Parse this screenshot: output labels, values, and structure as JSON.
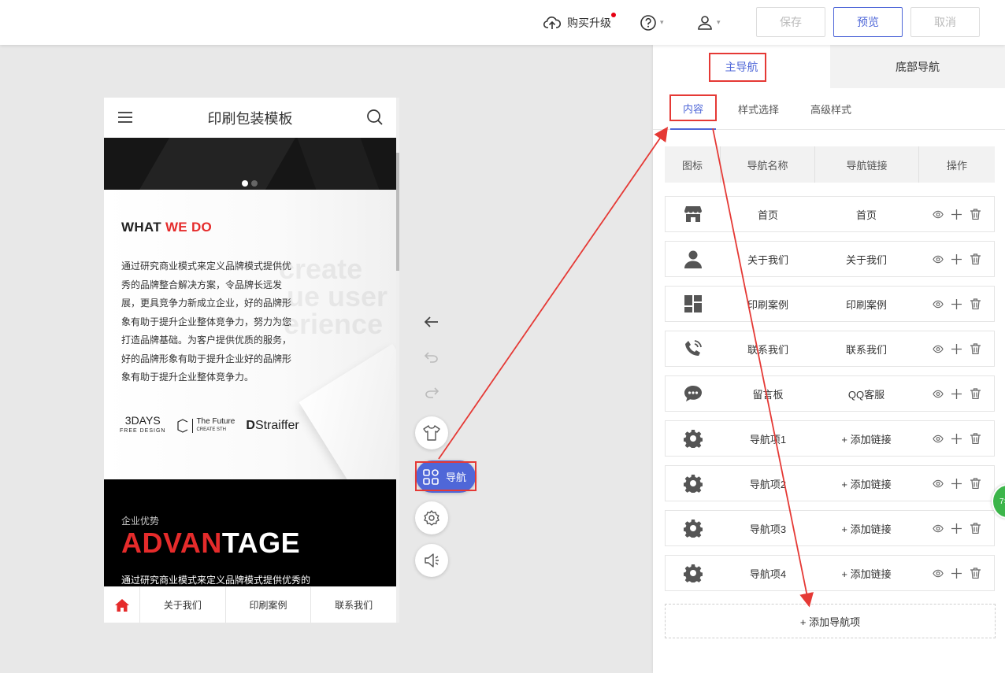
{
  "topbar": {
    "upgrade_label": "购买升级",
    "save_label": "保存",
    "preview_label": "预览",
    "cancel_label": "取消"
  },
  "phone": {
    "title": "印刷包装模板",
    "whatwedo": {
      "title_black": "WHAT ",
      "title_red": "WE DO",
      "paragraph": "通过研究商业模式来定义品牌模式提供优秀的品牌整合解决方案，令品牌长远发展，更具竞争力新成立企业，好的品牌形象有助于提升企业整体竞争力，努力为您打造品牌基础。为客户提供优质的服务，好的品牌形象有助于提升企业好的品牌形象有助于提升企业整体竞争力。",
      "bg_words": [
        "create",
        "ue user",
        "erience"
      ],
      "logos": {
        "logo1_main": "3DAYS",
        "logo1_sub": "FREE DESIGN",
        "logo2_main": "The Future",
        "logo2_sub": "CREATE STH",
        "logo3": "Straiffer"
      }
    },
    "advantage": {
      "small": "企业优势",
      "big_red": "ADVAN",
      "big_white": "TAGE",
      "text": "通过研究商业模式来定义品牌模式提供优秀的"
    },
    "bottom_nav": [
      "关于我们",
      "印刷案例",
      "联系我们"
    ]
  },
  "side_tools": {
    "nav_label": "导航"
  },
  "panel": {
    "tabs": {
      "main": "主导航",
      "bottom": "底部导航"
    },
    "subtabs": {
      "content": "内容",
      "style": "样式选择",
      "advanced": "高级样式"
    },
    "columns": {
      "icon": "图标",
      "name": "导航名称",
      "link": "导航链接",
      "ops": "操作"
    },
    "rows": [
      {
        "icon": "store-icon",
        "name": "首页",
        "link": "首页"
      },
      {
        "icon": "person-icon",
        "name": "关于我们",
        "link": "关于我们"
      },
      {
        "icon": "grid-icon",
        "name": "印刷案例",
        "link": "印刷案例"
      },
      {
        "icon": "phone-icon",
        "name": "联系我们",
        "link": "联系我们"
      },
      {
        "icon": "chat-icon",
        "name": "留言板",
        "link": "QQ客服"
      },
      {
        "icon": "gear-icon",
        "name": "导航项1",
        "link": "+ 添加链接"
      },
      {
        "icon": "gear-icon",
        "name": "导航项2",
        "link": "+ 添加链接"
      },
      {
        "icon": "gear-icon",
        "name": "导航项3",
        "link": "+ 添加链接"
      },
      {
        "icon": "gear-icon",
        "name": "导航项4",
        "link": "+ 添加链接"
      }
    ],
    "add_nav_label": "+ 添加导航项"
  },
  "colors": {
    "accent": "#4f67d8",
    "highlight": "#e53935",
    "brand_red": "#e52b2b"
  }
}
